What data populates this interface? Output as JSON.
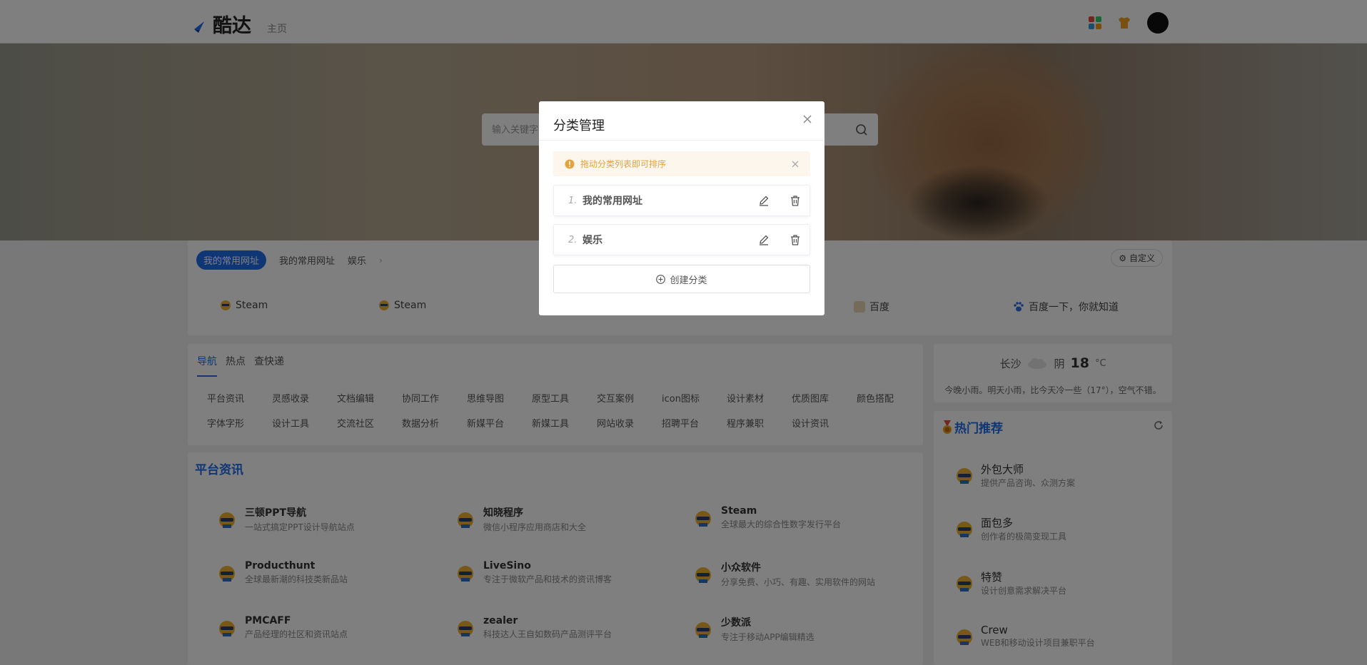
{
  "header": {
    "logo_text": "酷达",
    "home_link": "主页"
  },
  "search": {
    "placeholder": "输入关键字"
  },
  "category_bar": {
    "pills": [
      "我的常用网址",
      "我的常用网址",
      "娱乐"
    ],
    "custom_label": "自定义",
    "sites": [
      {
        "label": "Steam"
      },
      {
        "label": "Steam"
      },
      {
        "label": "百度"
      },
      {
        "label": "百度一下，你就知道"
      }
    ]
  },
  "nav": {
    "tabs": [
      "导航",
      "热点",
      "查快递"
    ],
    "items": [
      "平台资讯",
      "灵感收录",
      "文档编辑",
      "协同工作",
      "思维导图",
      "原型工具",
      "交互案例",
      "icon图标",
      "设计素材",
      "优质图库",
      "颜色搭配",
      "字体字形",
      "设计工具",
      "交流社区",
      "数据分析",
      "新媒平台",
      "新媒工具",
      "网站收录",
      "招聘平台",
      "程序兼职",
      "设计资讯"
    ]
  },
  "weather": {
    "city": "长沙",
    "condition": "阴",
    "temp": "18",
    "unit": "°C",
    "desc": "今晚小雨。明天小雨，比今天冷一些（17°），空气不错。"
  },
  "hot": {
    "title": "热门推荐",
    "items": [
      {
        "name": "外包大师",
        "desc": "提供产品咨询、众测方案"
      },
      {
        "name": "面包多",
        "desc": "创作者的极简变现工具"
      },
      {
        "name": "特赞",
        "desc": "设计创意需求解决平台"
      },
      {
        "name": "Crew",
        "desc": "WEB和移动设计项目兼职平台"
      }
    ]
  },
  "platform": {
    "title": "平台资讯",
    "items": [
      {
        "name": "三顿PPT导航",
        "desc": "一站式搞定PPT设计导航站点"
      },
      {
        "name": "知晓程序",
        "desc": "微信小程序应用商店和大全"
      },
      {
        "name": "Steam",
        "desc": "全球最大的综合性数字发行平台"
      },
      {
        "name": "Producthunt",
        "desc": "全球最新潮的科技类新品站"
      },
      {
        "name": "LiveSino",
        "desc": "专注于微软产品和技术的资讯博客"
      },
      {
        "name": "小众软件",
        "desc": "分享免费、小巧、有趣、实用软件的网站"
      },
      {
        "name": "PMCAFF",
        "desc": "产品经理的社区和资讯站点"
      },
      {
        "name": "zealer",
        "desc": "科技达人王自如数码产品测评平台"
      },
      {
        "name": "少数派",
        "desc": "专注于移动APP编辑精选"
      }
    ]
  },
  "modal": {
    "title": "分类管理",
    "alert": "拖动分类列表即可排序",
    "categories": [
      {
        "index": "1.",
        "name": "我的常用网址"
      },
      {
        "index": "2.",
        "name": "娱乐"
      }
    ],
    "create_label": "创建分类"
  },
  "colors": {
    "accent": "#1f6feb",
    "warning": "#e6a23c",
    "warning_bg": "#fdf6ec"
  }
}
